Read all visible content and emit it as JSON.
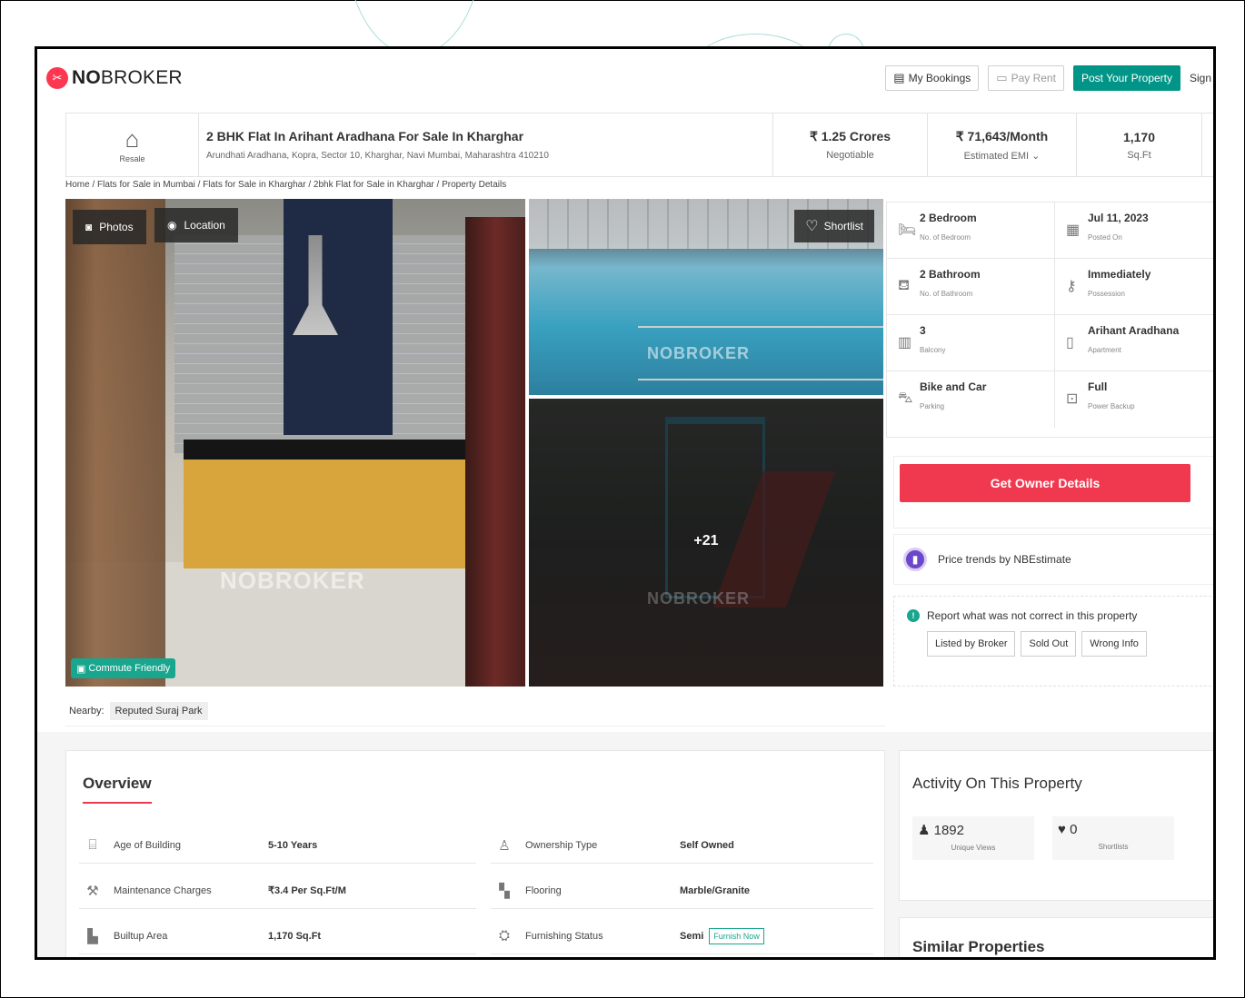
{
  "header": {
    "brand_bold": "NO",
    "brand_rest": "BROKER",
    "nav": {
      "my_bookings": "My Bookings",
      "pay_rent": "Pay Rent",
      "post_property": "Post Your Property",
      "sign_in": "Sign up"
    }
  },
  "listing": {
    "badge": "Resale",
    "title": "2 BHK Flat In Arihant Aradhana For Sale In Kharghar",
    "address": "Arundhati Aradhana, Kopra, Sector 10, Kharghar, Navi Mumbai, Maharashtra 410210",
    "price": "₹ 1.25 Crores",
    "price_note": "Negotiable",
    "emi": "₹ 71,643/Month",
    "emi_note": "Estimated EMI ⌄",
    "area": "1,170",
    "area_unit": "Sq.Ft"
  },
  "breadcrumb": "Home / Flats for Sale in Mumbai / Flats for Sale in Kharghar / 2bhk Flat for Sale in Kharghar / Property Details",
  "gallery": {
    "photos_label": "Photos",
    "location_label": "Location",
    "shortlist_label": "Shortlist",
    "commute_label": "Commute Friendly",
    "more_count": "+21",
    "watermark": "NOBROKER"
  },
  "nearby": {
    "label": "Nearby:",
    "tag": "Reputed Suraj Park"
  },
  "details": [
    {
      "value": "2 Bedroom",
      "label": "No. of Bedroom",
      "icon": "bed-icon"
    },
    {
      "value": "Jul 11, 2023",
      "label": "Posted On",
      "icon": "calendar-icon"
    },
    {
      "value": "2 Bathroom",
      "label": "No. of Bathroom",
      "icon": "bath-icon"
    },
    {
      "value": "Immediately",
      "label": "Possession",
      "icon": "key-icon"
    },
    {
      "value": "3",
      "label": "Balcony",
      "icon": "balcony-icon"
    },
    {
      "value": "Arihant Aradhana",
      "label": "Apartment",
      "icon": "building-icon"
    },
    {
      "value": "Bike and Car",
      "label": "Parking",
      "icon": "car-icon"
    },
    {
      "value": "Full",
      "label": "Power Backup",
      "icon": "power-icon"
    }
  ],
  "owner_button": "Get Owner Details",
  "price_trends": "Price trends by NBEstimate",
  "report": {
    "label": "Report what was not correct in this property",
    "options": [
      "Listed by Broker",
      "Sold Out",
      "Wrong Info"
    ]
  },
  "overview": {
    "title": "Overview",
    "rows": [
      [
        {
          "label": "Age of Building",
          "value": "5-10 Years",
          "icon": "building-age-icon"
        },
        {
          "label": "Ownership Type",
          "value": "Self Owned",
          "icon": "ownership-icon"
        }
      ],
      [
        {
          "label": "Maintenance Charges",
          "value": "₹3.4 Per Sq.Ft/M",
          "icon": "maintenance-icon"
        },
        {
          "label": "Flooring",
          "value": "Marble/Granite",
          "icon": "flooring-icon"
        }
      ],
      [
        {
          "label": "Builtup Area",
          "value": "1,170 Sq.Ft",
          "icon": "builtup-area-icon"
        },
        {
          "label": "Furnishing Status",
          "value": "Semi",
          "icon": "furnishing-icon"
        }
      ]
    ],
    "furnish_now": "Furnish Now"
  },
  "activity": {
    "title": "Activity On This Property",
    "stats": [
      {
        "value": "1892",
        "label": "Unique Views",
        "icon": "user-icon"
      },
      {
        "value": "0",
        "label": "Shortlists",
        "icon": "heart-icon"
      }
    ]
  },
  "similar_title": "Similar Properties",
  "colors": {
    "brand_red": "#fd3752",
    "cta_red": "#f0384f",
    "teal": "#009587",
    "purple": "#6d47c9"
  }
}
